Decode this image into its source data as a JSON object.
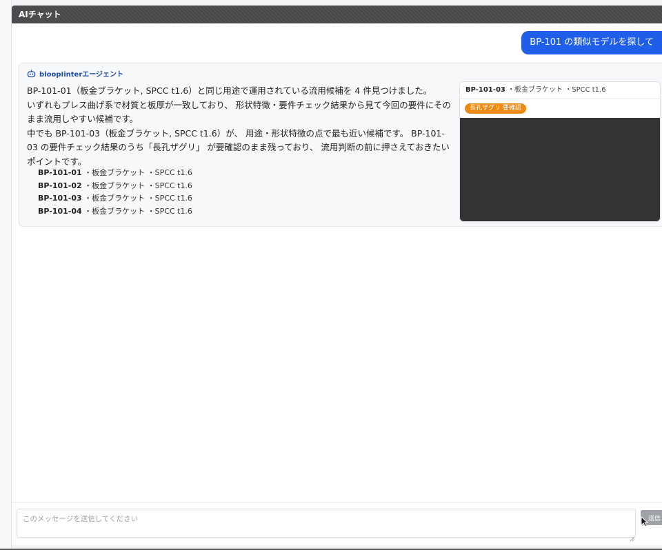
{
  "window": {
    "title": "AIチャット"
  },
  "user_message": {
    "text": "BP-101 の類似モデルを探して"
  },
  "agent": {
    "name": "bloopIinterエージェント",
    "paragraphs": [
      "BP-101-01（板金ブラケット, SPCC t1.6）と同じ用途で運用されている流用候補を 4 件見つけました。",
      "いずれもプレス曲げ系で材質と板厚が一致しており、 形状特徴・要件チェック結果から見て今回の要件にそのまま流用しやすい候補です。",
      "中でも BP-101-03（板金ブラケット, SPCC t1.6）が、 用途・形状特徴の点で最も近い候補です。 BP-101-03 の要件チェック結果のうち「長孔ザグリ」 が要確認のまま残っており、 流用判断の前に押さえておきたいポイントです。"
    ],
    "candidates": [
      {
        "id": "BP-101-01",
        "detail": "・板金ブラケット ・SPCC t1.6"
      },
      {
        "id": "BP-101-02",
        "detail": "・板金ブラケット ・SPCC t1.6"
      },
      {
        "id": "BP-101-03",
        "detail": "・板金ブラケット ・SPCC t1.6"
      },
      {
        "id": "BP-101-04",
        "detail": "・板金ブラケット ・SPCC t1.6"
      }
    ],
    "preview": {
      "id": "BP-101-03",
      "detail": "・板金ブラケット ・SPCC t1.6",
      "badge": "長孔ザグリ 要確認"
    }
  },
  "composer": {
    "placeholder": "このメッセージを送信してください",
    "send_label": "送信"
  },
  "colors": {
    "accent": "#1f5ee8",
    "badge": "#ea8a12",
    "titlebar": "#4a4a4c",
    "viewer": "#343436"
  }
}
